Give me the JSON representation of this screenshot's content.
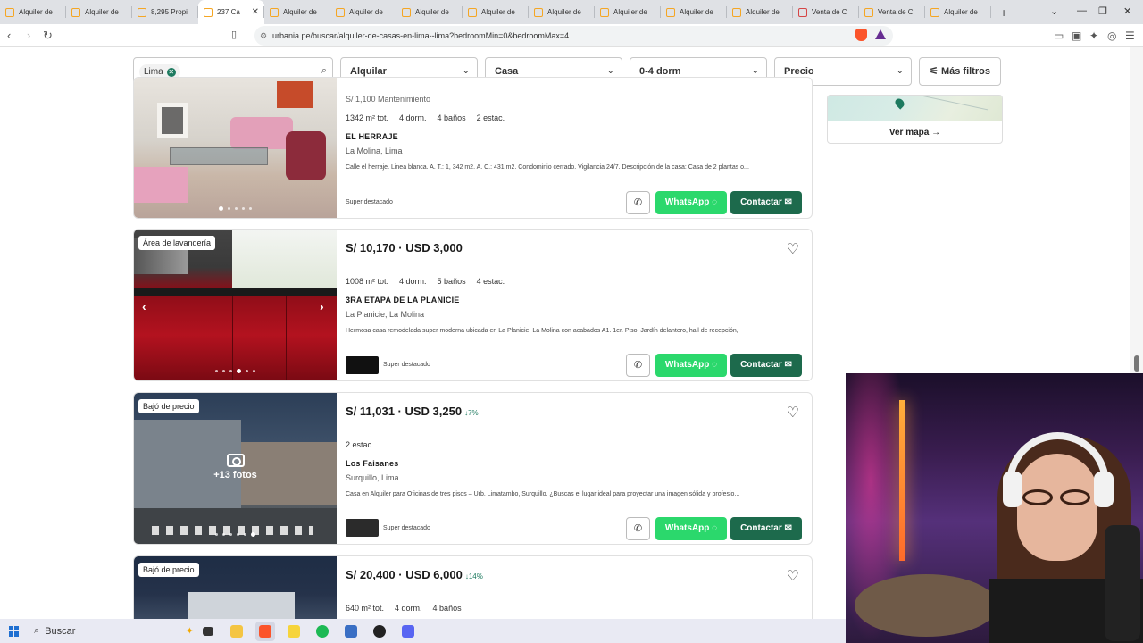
{
  "browser": {
    "tabs": [
      {
        "label": "Alquiler de",
        "active": false
      },
      {
        "label": "Alquiler de",
        "active": false
      },
      {
        "label": "8,295 Propi",
        "active": false
      },
      {
        "label": "237 Ca",
        "active": true
      },
      {
        "label": "Alquiler de",
        "active": false
      },
      {
        "label": "Alquiler de",
        "active": false
      },
      {
        "label": "Alquiler de",
        "active": false
      },
      {
        "label": "Alquiler de",
        "active": false
      },
      {
        "label": "Alquiler de",
        "active": false
      },
      {
        "label": "Alquiler de",
        "active": false
      },
      {
        "label": "Alquiler de",
        "active": false
      },
      {
        "label": "Alquiler de",
        "active": false
      },
      {
        "label": "Venta de C",
        "active": false
      },
      {
        "label": "Venta de C",
        "active": false
      },
      {
        "label": "Alquiler de",
        "active": false
      }
    ],
    "new_tab": "+",
    "url": "urbania.pe/buscar/alquiler-de-casas-en-lima--lima?bedroomMin=0&bedroomMax=4"
  },
  "filters": {
    "search_chip": "Lima",
    "operation": "Alquilar",
    "property_type": "Casa",
    "bedrooms": "0-4 dorm",
    "price": "Precio",
    "more_filters": "Más filtros"
  },
  "map": {
    "button": "Ver mapa →"
  },
  "listings": [
    {
      "maintenance": "S/ 1,100 Mantenimiento",
      "features": [
        "1342 m² tot.",
        "4 dorm.",
        "4 baños",
        "2 estac."
      ],
      "title": "EL HERRAJE",
      "location": "La Molina, Lima",
      "description": "Calle el herraje. Linea blanca. A. T.: 1, 342 m2. A. C.: 431 m2. Condominio cerrado. Vigilancia 24/7. Descripción de la casa: Casa de 2 plantas o...",
      "tag": "Super destacado",
      "whatsapp": "WhatsApp",
      "contact": "Contactar"
    },
    {
      "badge": "Área de lavandería",
      "price": "S/ 10,170 · USD 3,000",
      "features": [
        "1008 m² tot.",
        "4 dorm.",
        "5 baños",
        "4 estac."
      ],
      "title": "3RA ETAPA DE LA PLANICIE",
      "location": "La Planicie, La Molina",
      "description": "Hermosa casa remodelada super moderna ubicada en La Planicie, La Molina con acabados A1. 1er. Piso: Jardín delantero, hall de recepción,",
      "tag": "Super destacado",
      "whatsapp": "WhatsApp",
      "contact": "Contactar"
    },
    {
      "badge": "Bajó de precio",
      "price": "S/ 11,031 · USD 3,250",
      "price_drop": "↓7%",
      "photos": "+13 fotos",
      "features": [
        "2 estac."
      ],
      "title": "Los Faisanes",
      "location": "Surquillo, Lima",
      "description": "Casa en Alquiler para Oficinas de tres pisos – Urb. Limatambo, Surquillo. ¿Buscas el lugar ideal para proyectar una imagen sólida y profesio...",
      "tag": "Super destacado",
      "whatsapp": "WhatsApp",
      "contact": "Contactar"
    },
    {
      "badge": "Bajó de precio",
      "price": "S/ 20,400 · USD 6,000",
      "price_drop": "↓14%",
      "features": [
        "640 m² tot.",
        "4 dorm.",
        "4 baños"
      ]
    }
  ],
  "taskbar": {
    "search": "Buscar"
  }
}
